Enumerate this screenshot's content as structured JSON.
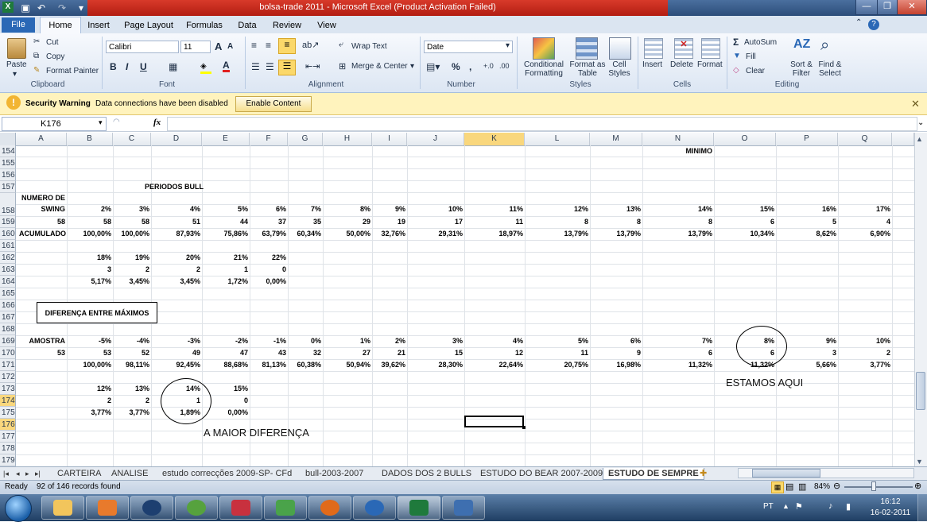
{
  "window": {
    "title": "bolsa-trade 2011  -  Microsoft Excel (Product Activation Failed)"
  },
  "ribbon_tabs": [
    "File",
    "Home",
    "Insert",
    "Page Layout",
    "Formulas",
    "Data",
    "Review",
    "View"
  ],
  "ribbon": {
    "clipboard": {
      "paste": "Paste",
      "cut": "Cut",
      "copy": "Copy",
      "format_painter": "Format Painter",
      "label": "Clipboard"
    },
    "font": {
      "name": "Calibri",
      "size": "11",
      "bold": "B",
      "italic": "I",
      "underline": "U",
      "grow": "A",
      "shrink": "A",
      "label": "Font"
    },
    "alignment": {
      "wrap": "Wrap Text",
      "merge": "Merge & Center",
      "label": "Alignment"
    },
    "number": {
      "format": "Date",
      "percent": "%",
      "comma": ",",
      "label": "Number"
    },
    "styles": {
      "conditional": "Conditional Formatting",
      "table": "Format as Table",
      "cell": "Cell Styles",
      "label": "Styles"
    },
    "cells": {
      "insert": "Insert",
      "delete": "Delete",
      "format": "Format",
      "label": "Cells"
    },
    "editing": {
      "autosum": "AutoSum",
      "fill": "Fill",
      "clear": "Clear",
      "sort": "Sort & Filter",
      "find": "Find & Select",
      "label": "Editing"
    }
  },
  "security": {
    "title": "Security Warning",
    "message": "Data connections have been disabled",
    "button": "Enable Content"
  },
  "formula_bar": {
    "name_box": "K176",
    "fx": "fx",
    "value": ""
  },
  "columns": [
    "A",
    "B",
    "C",
    "D",
    "E",
    "F",
    "G",
    "H",
    "I",
    "J",
    "K",
    "L",
    "M",
    "N",
    "O",
    "P",
    "Q"
  ],
  "rows": [
    "154",
    "155",
    "156",
    "157",
    "158",
    "159",
    "160",
    "161",
    "162",
    "163",
    "164",
    "165",
    "166",
    "167",
    "168",
    "169",
    "170",
    "171",
    "172",
    "173",
    "174",
    "175",
    "176",
    "177",
    "178",
    "179"
  ],
  "cells": {
    "r154_N": "MINIMO",
    "r157_D": "PERIODOS BULL",
    "r158_A1": "NUMERO DE",
    "r158_A2": "SWING",
    "r158": [
      "2%",
      "3%",
      "4%",
      "5%",
      "6%",
      "7%",
      "8%",
      "9%",
      "10%",
      "11%",
      "12%",
      "13%",
      "14%",
      "15%",
      "16%",
      "17%"
    ],
    "r159_A": "58",
    "r159": [
      "58",
      "58",
      "51",
      "44",
      "37",
      "35",
      "29",
      "19",
      "17",
      "11",
      "8",
      "8",
      "8",
      "6",
      "5",
      "4"
    ],
    "r160_A": "ACUMULADO",
    "r160": [
      "100,00%",
      "100,00%",
      "87,93%",
      "75,86%",
      "63,79%",
      "60,34%",
      "50,00%",
      "32,76%",
      "29,31%",
      "18,97%",
      "13,79%",
      "13,79%",
      "13,79%",
      "10,34%",
      "8,62%",
      "6,90%"
    ],
    "r162": [
      "18%",
      "19%",
      "20%",
      "21%",
      "22%"
    ],
    "r163": [
      "3",
      "2",
      "2",
      "1",
      "0"
    ],
    "r164": [
      "5,17%",
      "3,45%",
      "3,45%",
      "1,72%",
      "0,00%"
    ],
    "r167_A": "DIFERENÇA ENTRE MÁXIMOS",
    "r169_A": "AMOSTRA",
    "r169": [
      "-5%",
      "-4%",
      "-3%",
      "-2%",
      "-1%",
      "0%",
      "1%",
      "2%",
      "3%",
      "4%",
      "5%",
      "6%",
      "7%",
      "8%",
      "9%",
      "10%"
    ],
    "r170_A": "53",
    "r170": [
      "53",
      "52",
      "49",
      "47",
      "43",
      "32",
      "27",
      "21",
      "15",
      "12",
      "11",
      "9",
      "6",
      "6",
      "3",
      "2"
    ],
    "r171": [
      "100,00%",
      "98,11%",
      "92,45%",
      "88,68%",
      "81,13%",
      "60,38%",
      "50,94%",
      "39,62%",
      "28,30%",
      "22,64%",
      "20,75%",
      "16,98%",
      "11,32%",
      "11,32%",
      "5,66%",
      "3,77%"
    ],
    "r173": [
      "12%",
      "13%",
      "14%",
      "15%"
    ],
    "r174": [
      "2",
      "2",
      "1",
      "0"
    ],
    "r175": [
      "3,77%",
      "3,77%",
      "1,89%",
      "0,00%"
    ],
    "ann_estamos": "ESTAMOS AQUI",
    "ann_maior": "A MAIOR DIFERENÇA"
  },
  "sheet_tabs": [
    "CARTEIRA",
    "ANALISE",
    "estudo correcções 2009-SP- CFd",
    "bull-2003-2007",
    "DADOS DOS 2 BULLS",
    "ESTUDO DO BEAR 2007-2009",
    "ESTUDO DE SEMPRE"
  ],
  "status": {
    "ready": "Ready",
    "records": "92 of 146 records found",
    "zoom": "84%"
  },
  "taskbar": {
    "lang": "PT",
    "time": "16:12",
    "date": "16-02-2011"
  }
}
